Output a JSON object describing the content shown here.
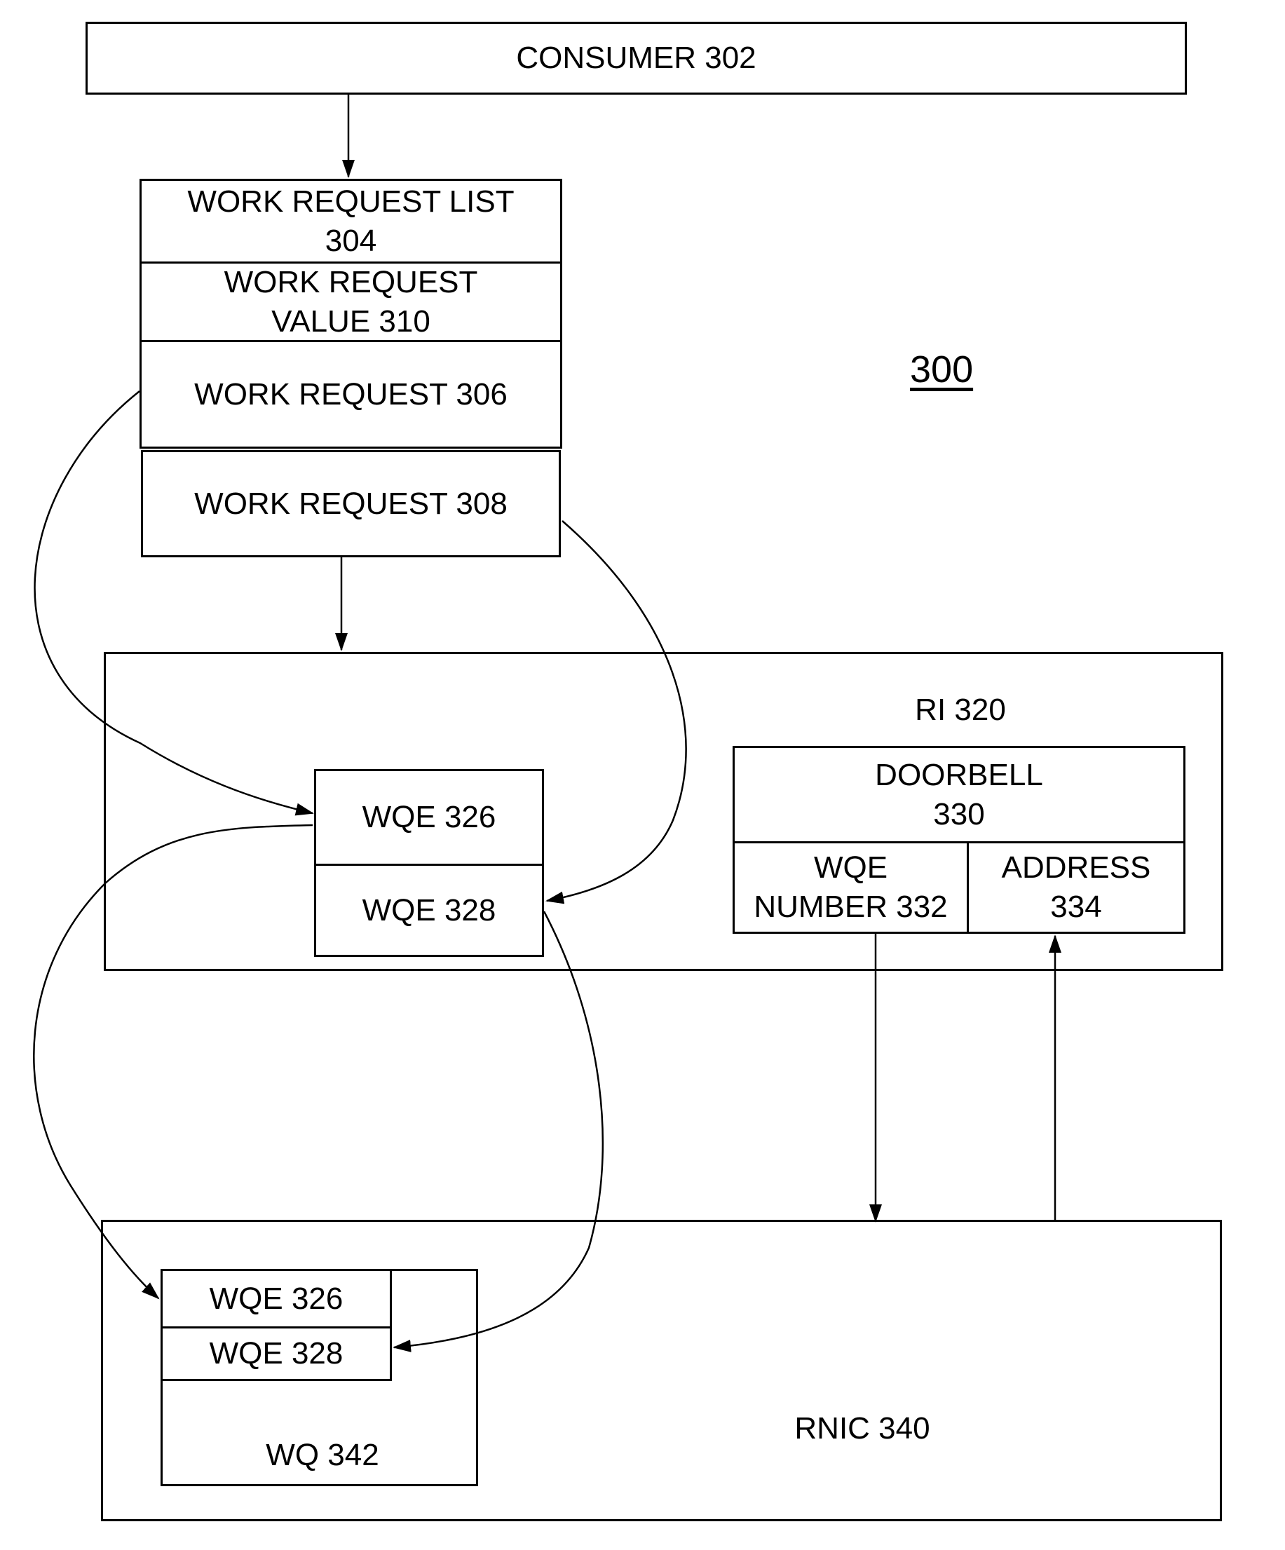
{
  "figure_number": "300",
  "consumer": {
    "label": "CONSUMER 302"
  },
  "work_request_list": {
    "header": "WORK REQUEST LIST\n304",
    "value": "WORK REQUEST\nVALUE 310",
    "requests": [
      "WORK REQUEST 306",
      "WORK REQUEST 308"
    ]
  },
  "ri": {
    "label": "RI 320",
    "wqes": [
      "WQE 326",
      "WQE 328"
    ],
    "doorbell": {
      "label": "DOORBELL\n330",
      "wqe_number": "WQE\nNUMBER 332",
      "address": "ADDRESS\n334"
    }
  },
  "rnic": {
    "label": "RNIC 340",
    "wq": {
      "label": "WQ 342",
      "wqes": [
        "WQE 326",
        "WQE 328"
      ]
    }
  },
  "connections": [
    {
      "from": "consumer",
      "to": "work-request-list",
      "kind": "arrow"
    },
    {
      "from": "work-request-list",
      "to": "ri",
      "kind": "arrow"
    },
    {
      "from": "work-request-306",
      "to": "ri-wqe-326",
      "kind": "curved-arrow"
    },
    {
      "from": "work-request-308",
      "to": "ri-wqe-328",
      "kind": "curved-arrow"
    },
    {
      "from": "ri-wqe-326",
      "to": "wq-wqe-326",
      "kind": "curved-arrow"
    },
    {
      "from": "ri-wqe-328",
      "to": "wq-wqe-328",
      "kind": "curved-arrow"
    },
    {
      "from": "wqe-number",
      "to": "rnic",
      "kind": "arrow"
    },
    {
      "from": "rnic",
      "to": "address",
      "kind": "arrow"
    }
  ]
}
